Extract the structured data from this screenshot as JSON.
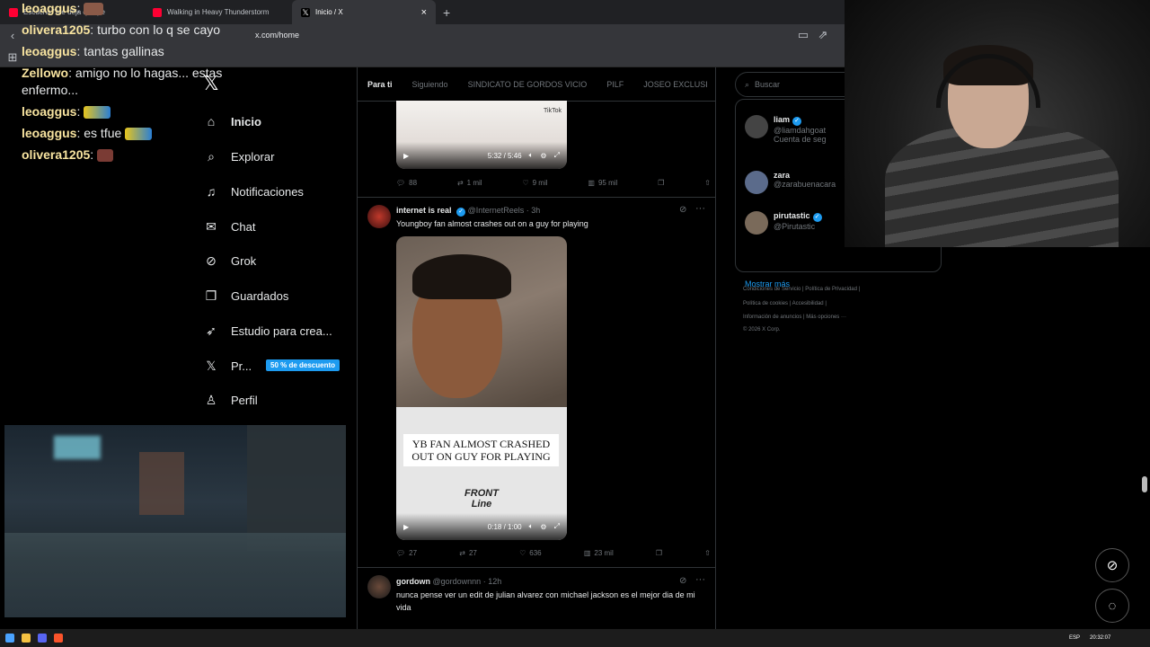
{
  "browser": {
    "tabs": [
      {
        "title": "Escucha \"me deja que pe",
        "active": false
      },
      {
        "title": "Walking in Heavy Thunderstorm",
        "active": false
      },
      {
        "title": "Inicio / X",
        "active": true
      }
    ],
    "url": "x.com/home",
    "new_tab": "+",
    "close": "×"
  },
  "chat": {
    "messages": [
      {
        "user": "leoaggus",
        "text": ""
      },
      {
        "user": "olivera1205",
        "text": "turbo con lo q se cayo"
      },
      {
        "user": "leoaggus",
        "text": "tantas gallinas"
      },
      {
        "user": "Zellowo",
        "text": "amigo no lo hagas... estas enfermo..."
      },
      {
        "user": "leoaggus",
        "text": ""
      },
      {
        "user": "leoaggus",
        "text": "es tfue"
      },
      {
        "user": "olivera1205",
        "text": ""
      }
    ]
  },
  "x": {
    "logo": "𝕏",
    "nav": [
      {
        "label": "Inicio",
        "icon": "home-icon",
        "glyph": "⌂"
      },
      {
        "label": "Explorar",
        "icon": "search-icon",
        "glyph": "⌕"
      },
      {
        "label": "Notificaciones",
        "icon": "bell-icon",
        "glyph": "♫"
      },
      {
        "label": "Chat",
        "icon": "mail-icon",
        "glyph": "✉"
      },
      {
        "label": "Grok",
        "icon": "grok-icon",
        "glyph": "⊘"
      },
      {
        "label": "Guardados",
        "icon": "bookmark-icon",
        "glyph": "❐"
      },
      {
        "label": "Estudio para crea...",
        "icon": "rocket-icon",
        "glyph": "➶"
      },
      {
        "label": "Pr...",
        "icon": "x-premium-icon",
        "glyph": "𝕏"
      },
      {
        "label": "Perfil",
        "icon": "profile-icon",
        "glyph": "♙"
      }
    ],
    "promo_badge": "50 % de descuento",
    "feed_tabs": [
      "Para ti",
      "Siguiendo",
      "SINDICATO DE GORDOS VICIO",
      "PILF",
      "JOSEO EXCLUSI"
    ],
    "post1": {
      "time": "5:32 / 5:46",
      "replies": "88",
      "reposts": "1 mil",
      "likes": "9 mil",
      "views": "95 mil",
      "watermark": "TikTok"
    },
    "post2": {
      "name": "internet is real",
      "handle": "@InternetReels",
      "age": "· 3h",
      "text": "Youngboy fan almost crashes out on a guy for playing",
      "caption": "YB FAN ALMOST CRASHED OUT ON GUY FOR PLAYING",
      "overlay_logo": "FRONT Line",
      "time": "0:18 / 1:00",
      "replies": "27",
      "reposts": "27",
      "likes": "636",
      "views": "23 mil"
    },
    "post3": {
      "name": "gordown",
      "handle": "@gordownnn",
      "age": "· 12h",
      "text": "nunca pense ver un edit de julian alvarez con michael jackson es el mejor dia de mi vida"
    },
    "search_placeholder": "Buscar",
    "who_to_follow": [
      {
        "name": "liam",
        "handle": "@liamdahgoat",
        "note": "Cuenta de seg",
        "verified": true
      },
      {
        "name": "zara",
        "handle": "@zarabuenacara",
        "note": "",
        "verified": false
      },
      {
        "name": "pirutastic",
        "handle": "@Pirutastic",
        "note": "",
        "verified": true
      }
    ],
    "show_more": "Mostrar más",
    "footer": [
      [
        "Condiciones de Servicio",
        "|",
        "Política de Privacidad",
        "|"
      ],
      [
        "Política de cookies",
        "|",
        "Accesibilidad",
        "|"
      ],
      [
        "Información de anuncios",
        "|",
        "Más opciones ···"
      ],
      [
        "© 2026 X Corp."
      ]
    ]
  },
  "taskbar": {
    "lang": "ESP",
    "clock": "20:32:07"
  },
  "colors": {
    "accent": "#1d9bf0",
    "bg": "#000000",
    "border": "#2f3336",
    "muted": "#71767b",
    "chat_user": "#f8e4a0"
  }
}
